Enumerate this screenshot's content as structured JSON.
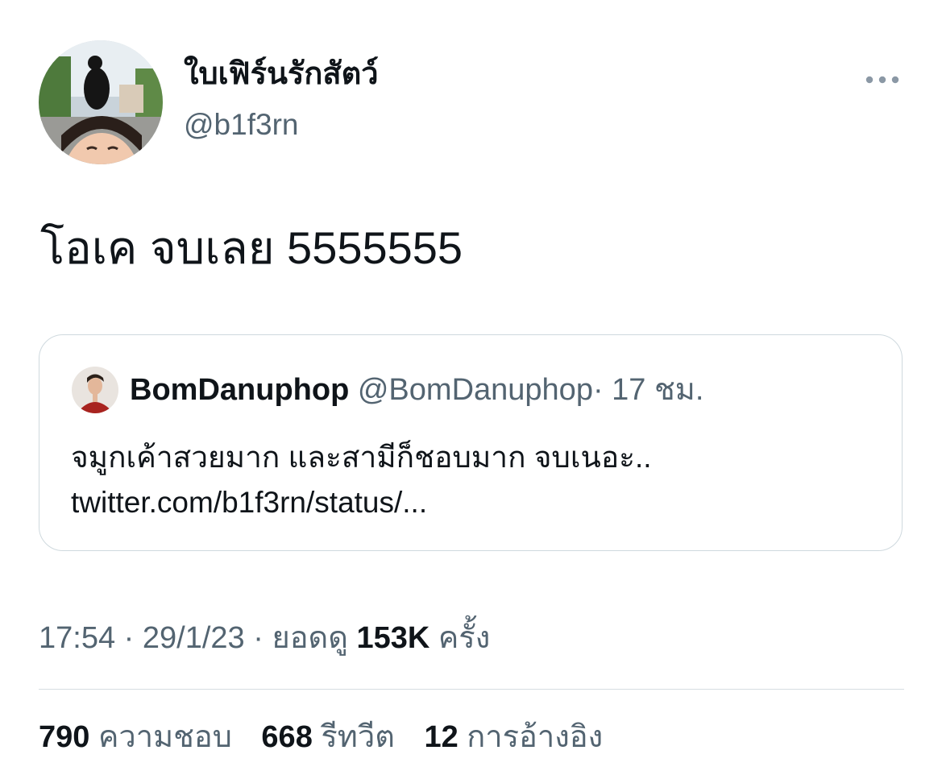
{
  "tweet": {
    "author": {
      "display_name": "ใบเฟิร์นรักสัตว์",
      "handle": "@b1f3rn"
    },
    "text": "โอเค จบเลย 5555555",
    "more_icon": "more-horizontal-icon",
    "quoted": {
      "display_name": "BomDanuphop",
      "handle": "@BomDanuphop",
      "separator": "·",
      "time": "17 ชม.",
      "text_line1": "จมูกเค้าสวยมาก และสามีก็ชอบมาก จบเนอะ..",
      "text_line2": "twitter.com/b1f3rn/status/..."
    },
    "meta": {
      "time": "17:54",
      "sep1": "·",
      "date": "29/1/23",
      "sep2": "·",
      "views_prefix": "ยอดดู",
      "views_count": "153K",
      "views_suffix": "ครั้ง"
    },
    "stats": {
      "likes_count": "790",
      "likes_label": "ความชอบ",
      "retweets_count": "668",
      "retweets_label": "รีทวีต",
      "quotes_count": "12",
      "quotes_label": "การอ้างอิง"
    }
  },
  "colors": {
    "text_primary": "#0f1419",
    "text_secondary": "#536471",
    "border": "#cfd9de"
  }
}
